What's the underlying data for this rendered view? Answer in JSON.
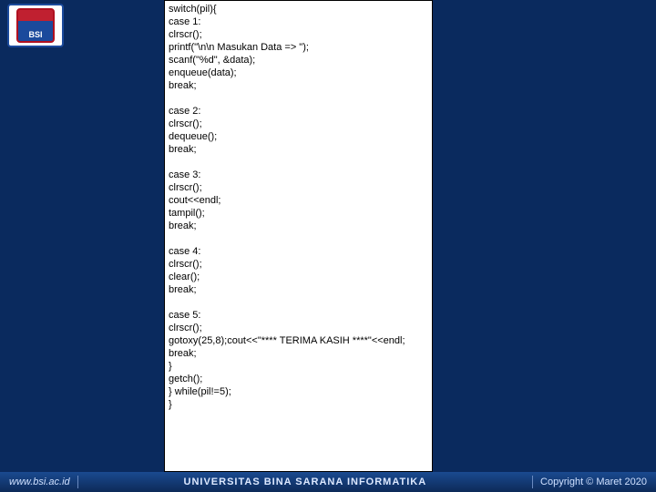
{
  "logo": {
    "abbrev": "BSI"
  },
  "code": {
    "lines": [
      "switch(pil){",
      "case 1:",
      "clrscr();",
      "printf(\"\\n\\n Masukan Data => \");",
      "scanf(\"%d\", &data);",
      "enqueue(data);",
      "break;",
      "",
      "case 2:",
      "clrscr();",
      "dequeue();",
      "break;",
      "",
      "case 3:",
      "clrscr();",
      "cout<<endl;",
      "tampil();",
      "break;",
      "",
      "case 4:",
      "clrscr();",
      "clear();",
      "break;",
      "",
      "case 5:",
      "clrscr();",
      "gotoxy(25,8);cout<<\"**** TERIMA KASIH ****\"<<endl;",
      "break;",
      "}",
      "getch();",
      "} while(pil!=5);",
      "}"
    ]
  },
  "footer": {
    "url": "www.bsi.ac.id",
    "org": "UNIVERSITAS BINA SARANA INFORMATIKA",
    "copyright": "Copyright © Maret 2020"
  }
}
